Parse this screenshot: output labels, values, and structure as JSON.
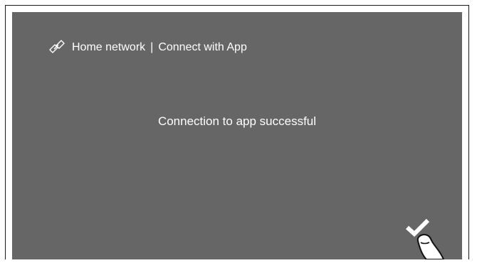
{
  "header": {
    "icon": "link-icon",
    "section": "Home network",
    "separator": "|",
    "page": "Connect with App"
  },
  "message": "Connection to app successful",
  "confirm": {
    "icon": "checkmark-icon"
  },
  "pointer": {
    "icon": "hand-pointer-icon"
  },
  "colors": {
    "screen_background": "#666666",
    "text": "#ffffff"
  }
}
